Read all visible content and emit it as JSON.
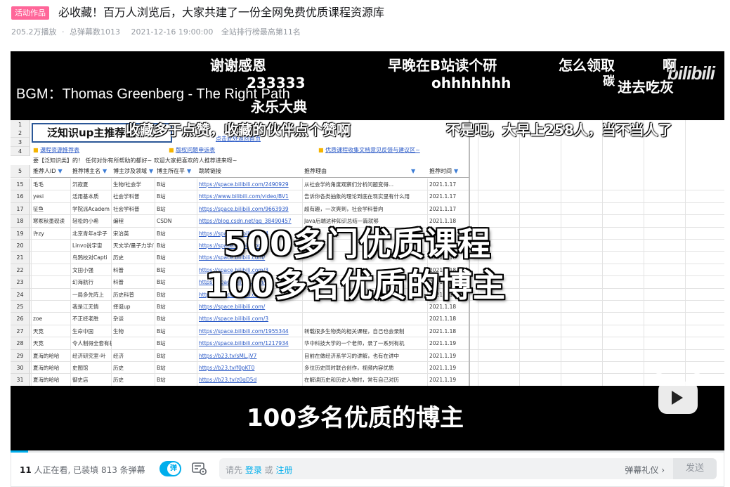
{
  "header": {
    "badge": "活动作品",
    "title": "必收藏！百万人浏览后，大家共建了一份全网免费优质课程资源库",
    "plays": "205.2万播放",
    "dot": "·",
    "danmaku": "总弹幕数1013",
    "date": "2021-12-16 19:00:00",
    "rank": "全站排行榜最高第11名"
  },
  "player": {
    "bgm": "BGM：Thomas Greenberg - The Right Path",
    "watermark": "bilibili",
    "danmu": [
      {
        "text": "谢谢感恩"
      },
      {
        "text": "早晚在B站读个研"
      },
      {
        "text": "怎么领取"
      },
      {
        "text": "啊"
      },
      {
        "text": "233333"
      },
      {
        "text": "ohhhhhhh"
      },
      {
        "text": "碳"
      },
      {
        "text": "进去吃灰"
      },
      {
        "text": "永乐大典"
      },
      {
        "text": "收藏多于点赞，收藏的伙伴点个赞啊"
      },
      {
        "text": "不是吧，大早上258人，当不当人了"
      }
    ],
    "overlay_line1": "500多门优质课程",
    "overlay_line2": "100多名优质的博主",
    "subtitle": "100多名优质的博主",
    "progress_fraction": 0.025
  },
  "sheet": {
    "title": "泛知识up主推荐区",
    "back_link": "点击此处返回首页",
    "links": [
      "课程资源推荐表",
      "版权问题申诉表",
      "优质课程收集文档意见反馈与建议区~"
    ],
    "notice": "要【泛知识类】的！ 任何对你有所帮助的都好~ 欢迎大家把喜欢的人推荐进来呀~",
    "headers": [
      "推荐人ID",
      "推荐博主名",
      "博主涉及领域",
      "博主所在平",
      "跳转链接",
      "推荐理由",
      "推荐时间"
    ],
    "row_numbers": [
      "1",
      "2",
      "3",
      "4",
      "5",
      "15",
      "16",
      "17",
      "18",
      "19",
      "20",
      "21",
      "22",
      "23",
      "24",
      "25",
      "26",
      "27",
      "28",
      "29",
      "30",
      "31",
      "32",
      "33"
    ],
    "rows": [
      {
        "n": "15",
        "c": [
          "毛毛",
          "沉寂夏",
          "生物/社会学",
          "B站",
          "https://space.bilibili.com/2490929",
          "从社会学的角度观察们分析问题变得...",
          "2021.1.17"
        ]
      },
      {
        "n": "16",
        "c": [
          "yesi",
          "活用基本质",
          "社会学科普",
          "B站",
          "https://www.bilibili.com/video/BV1",
          "告诉你各类抽象的理论到底在现实里有什么用",
          "2021.1.17"
        ]
      },
      {
        "n": "17",
        "c": [
          "征鱼",
          "学院派Academ",
          "社会学科普",
          "B站",
          "https://space.bilibili.com/9663939",
          "超有趣，一次爽到，社会学科普向",
          "2021.1.17"
        ]
      },
      {
        "n": "18",
        "c": [
          "寒冢秋墨砚读",
          "轻松的小希",
          "编程",
          "CSDN",
          "https://blog.csdn.net/qq_38490457",
          "Java后端这种知识总结一篇就够",
          "2021.1.18"
        ]
      },
      {
        "n": "19",
        "c": [
          "许zy",
          "北京青年a学子",
          "宋治英",
          "B站",
          "https://space.bilibili.com/4",
          "",
          "2021.1.18"
        ]
      },
      {
        "n": "20",
        "c": [
          "",
          "Linvo说宇宙",
          "天文学/量子力学/",
          "B站",
          "https://space.bilibili.com/",
          "",
          "2021.1.18"
        ]
      },
      {
        "n": "21",
        "c": [
          "",
          "鸟鸦校对Capti",
          "历史",
          "B站",
          "https://space.bilibili.com/",
          "",
          "2021.1.18"
        ]
      },
      {
        "n": "22",
        "c": [
          "",
          "文田小强",
          "科普",
          "B站",
          "https://space.bilibili.com/3",
          "",
          "2021.1.18"
        ]
      },
      {
        "n": "23",
        "c": [
          "",
          "幻海航行",
          "科普",
          "B站",
          "https://space.bilibili.com/6",
          "",
          "2021.1.18"
        ]
      },
      {
        "n": "24",
        "c": [
          "",
          "一局多先阵上",
          "历史科普",
          "B站",
          "https://space.bilibili.com/",
          "",
          "2021.1.18"
        ]
      },
      {
        "n": "25",
        "c": [
          "",
          "我是江无情",
          "择诞up",
          "B站",
          "https://space.bilibili.com/",
          "",
          "2021.1.18"
        ]
      },
      {
        "n": "26",
        "c": [
          "zoe",
          "不正经老胜",
          "杂谈",
          "B站",
          "https://space.bilibili.com/3",
          "",
          "2021.1.18"
        ]
      },
      {
        "n": "27",
        "c": [
          "天竞",
          "生命中国",
          "生物",
          "B站",
          "https://space.bilibili.com/1955344",
          "转载很多生物类的相关课程，自己也会录制",
          "2021.1.18"
        ]
      },
      {
        "n": "28",
        "c": [
          "天竞",
          "令人制得全套有机",
          "",
          "B站",
          "https://space.bilibili.com/1217934",
          "华中科技大学的一个老师，录了一系列有机",
          "2021.1.19"
        ]
      },
      {
        "n": "29",
        "c": [
          "夏海的哈哈",
          "经济研究室-叶",
          "经济",
          "B站",
          "https://b23.tv/sML.jV7",
          "目前在做经济系学习的讲解，也有在讲中",
          "2021.1.19"
        ]
      },
      {
        "n": "30",
        "c": [
          "夏海的哈哈",
          "史图馆",
          "历史",
          "B站",
          "https://b23.tv/f0pKT0",
          "多位历史同时联合创作，视频内容优质",
          "2021.1.19"
        ]
      },
      {
        "n": "31",
        "c": [
          "夏海的哈哈",
          "御史店",
          "历史",
          "B站",
          "https://b23.tv/z0gD5d",
          "在解读历史和历史人物时，常有自己对历",
          "2021.1.19"
        ]
      },
      {
        "n": "32",
        "c": [
          "Sobriety",
          "Frank-FuckPP",
          "数学",
          "B站",
          "https://b23.tv/Y0Kmuy",
          "讲的很好，up很其优秀，打破了死板数学",
          "2021.1.1.19"
        ]
      },
      {
        "n": "33",
        "c": [
          "Timeless",
          "英语兔",
          "英语",
          "B站",
          "https://space.bilibili.com/4831624",
          "在英语语言方面很好，学英语必看",
          "2021/1/19"
        ]
      }
    ]
  },
  "bottom_bar": {
    "viewers_count": "11",
    "viewers_text": " 人正在看, 已装填 813 条弹幕",
    "toggle_label": "弹",
    "input_prefix": "请先 ",
    "login": "登录",
    "or": " 或 ",
    "register": "注册",
    "etiquette": "弹幕礼仪",
    "etiquette_arrow": "›",
    "send": "发送"
  },
  "colors": {
    "accent": "#00aeec",
    "badge": "#ff6699",
    "meta": "#9499a0"
  }
}
